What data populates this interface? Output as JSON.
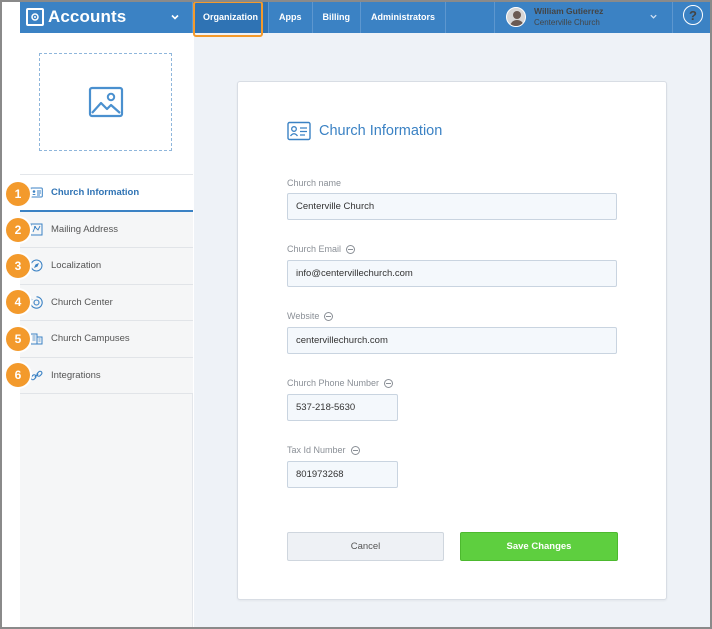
{
  "header": {
    "app_title": "Accounts",
    "nav": [
      {
        "label": "Organization",
        "active": true
      },
      {
        "label": "Apps",
        "active": false
      },
      {
        "label": "Billing",
        "active": false
      },
      {
        "label": "Administrators",
        "active": false
      }
    ],
    "user": {
      "name": "William Gutierrez",
      "org": "Centerville Church"
    },
    "help_glyph": "?"
  },
  "sidebar": {
    "items": [
      {
        "label": "Church Information",
        "icon": "id-card-icon",
        "step": "1",
        "active": true
      },
      {
        "label": "Mailing Address",
        "icon": "map-icon",
        "step": "2",
        "active": false
      },
      {
        "label": "Localization",
        "icon": "compass-icon",
        "step": "3",
        "active": false
      },
      {
        "label": "Church Center",
        "icon": "church-center-icon",
        "step": "4",
        "active": false
      },
      {
        "label": "Church Campuses",
        "icon": "buildings-icon",
        "step": "5",
        "active": false
      },
      {
        "label": "Integrations",
        "icon": "link-icon",
        "step": "6",
        "active": false
      }
    ]
  },
  "form": {
    "title": "Church Information",
    "fields": {
      "church_name": {
        "label": "Church name",
        "value": "Centerville Church"
      },
      "church_email": {
        "label": "Church Email",
        "value": "info@centervillechurch.com"
      },
      "website": {
        "label": "Website",
        "value": "centervillechurch.com"
      },
      "phone": {
        "label": "Church Phone Number",
        "value": "537-218-5630"
      },
      "tax_id": {
        "label": "Tax Id Number",
        "value": "801973268"
      }
    },
    "cancel_label": "Cancel",
    "save_label": "Save Changes"
  },
  "colors": {
    "topbar": "#3b82c4",
    "accent": "#3b82c4",
    "badge": "#f39a2c",
    "save": "#5ecf3f"
  }
}
